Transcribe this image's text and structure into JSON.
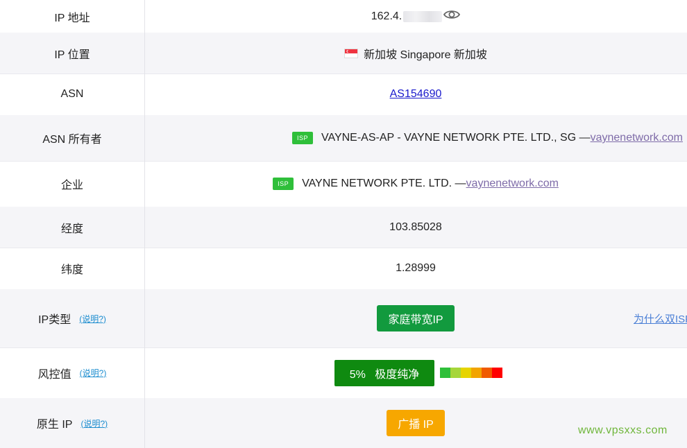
{
  "rows": {
    "ip_address": {
      "label": "IP 地址",
      "value": "162.4."
    },
    "ip_location": {
      "label": "IP 位置",
      "value": "新加坡 Singapore 新加坡"
    },
    "asn": {
      "label": "ASN",
      "value": "AS154690"
    },
    "asn_owner": {
      "label": "ASN 所有者",
      "badge": "ISP",
      "value": "VAYNE-AS-AP - VAYNE NETWORK PTE. LTD., SG —",
      "link": "vaynenetwork.com"
    },
    "company": {
      "label": "企业",
      "badge": "ISP",
      "value": "VAYNE NETWORK PTE. LTD. —",
      "link": "vaynenetwork.com"
    },
    "longitude": {
      "label": "经度",
      "value": "103.85028"
    },
    "latitude": {
      "label": "纬度",
      "value": "1.28999"
    },
    "ip_type": {
      "label": "IP类型",
      "help": "(说明?)",
      "value": "家庭带宽IP",
      "side_link": "为什么双ISP"
    },
    "risk": {
      "label": "风控值",
      "help": "(说明?)",
      "percent": "5%",
      "value": "极度纯净",
      "scale_colors": [
        "#2fbf3a",
        "#a6d63a",
        "#e6d400",
        "#f2a400",
        "#f05a00",
        "#ff0000"
      ]
    },
    "native_ip": {
      "label": "原生 IP",
      "help": "(说明?)",
      "value": "广播 IP"
    }
  },
  "icons": {
    "eye": "eye-icon",
    "flag": "singapore-flag-icon"
  },
  "watermark": "www.vpsxxs.com",
  "colors": {
    "accent_green": "#129a3e",
    "risk_green": "#0f8a10",
    "orange": "#f7a700",
    "isp_badge": "#2fbf3a"
  }
}
